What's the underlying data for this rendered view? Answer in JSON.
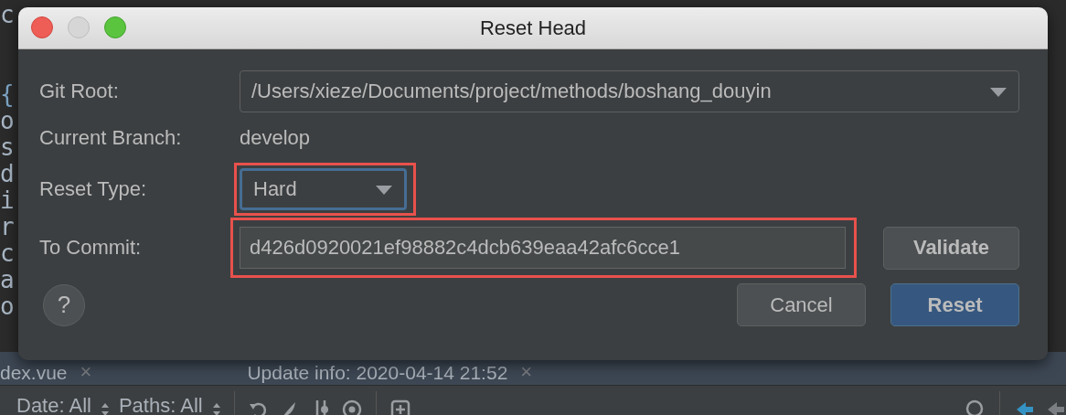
{
  "editor": {
    "code_lines": [
      "c",
      "{",
      "o",
      "s",
      "d",
      "i",
      "r",
      "c",
      "a",
      "o"
    ]
  },
  "file_tabs": [
    {
      "label": "dex.vue",
      "close": "×"
    },
    {
      "label": "Update info: 2020-04-14 21:52",
      "close": "×"
    }
  ],
  "log_toolbar": {
    "filters": [
      "Date: All",
      "Paths: All"
    ]
  },
  "dialog": {
    "title": "Reset Head",
    "git_root": {
      "label": "Git Root:",
      "value": "/Users/xieze/Documents/project/methods/boshang_douyin"
    },
    "current_branch": {
      "label": "Current Branch:",
      "value": "develop"
    },
    "reset_type": {
      "label": "Reset Type:",
      "value": "Hard",
      "focused": true,
      "highlighted": true
    },
    "to_commit": {
      "label": "To Commit:",
      "value": "d426d0920021ef98882c4dcb639eaa42afc6cce1",
      "highlighted": true
    },
    "validate_button": "Validate",
    "help_button": "?",
    "buttons": [
      {
        "label": "Cancel",
        "default": false
      },
      {
        "label": "Reset",
        "default": true
      }
    ]
  }
}
